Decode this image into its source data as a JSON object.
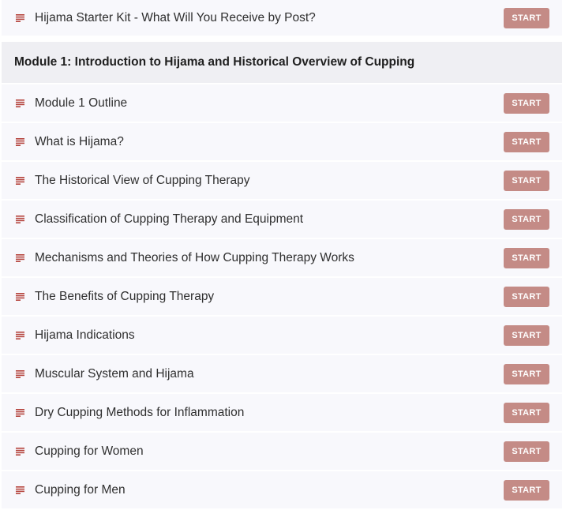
{
  "intro_lesson": {
    "title": "Hijama Starter Kit - What Will You Receive by Post?",
    "button_label": "START"
  },
  "module": {
    "title": "Module 1: Introduction to Hijama and Historical Overview of Cupping",
    "lessons": [
      {
        "title": "Module 1 Outline",
        "button_label": "START"
      },
      {
        "title": "What is Hijama?",
        "button_label": "START"
      },
      {
        "title": "The Historical View of Cupping Therapy",
        "button_label": "START"
      },
      {
        "title": "Classification of Cupping Therapy and Equipment",
        "button_label": "START"
      },
      {
        "title": "Mechanisms and Theories of How Cupping Therapy Works",
        "button_label": "START"
      },
      {
        "title": "The Benefits of Cupping Therapy",
        "button_label": "START"
      },
      {
        "title": "Hijama Indications",
        "button_label": "START"
      },
      {
        "title": "Muscular System and Hijama",
        "button_label": "START"
      },
      {
        "title": "Dry Cupping Methods for Inflammation",
        "button_label": "START"
      },
      {
        "title": "Cupping for Women",
        "button_label": "START"
      },
      {
        "title": "Cupping for Men",
        "button_label": "START"
      }
    ]
  },
  "icons": {
    "lesson_icon": "text-lines-icon"
  },
  "colors": {
    "accent_button": "#c48b86",
    "lesson_icon": "#b5443d",
    "row_background": "#f8f8fc",
    "module_header_background": "#efeff3"
  }
}
